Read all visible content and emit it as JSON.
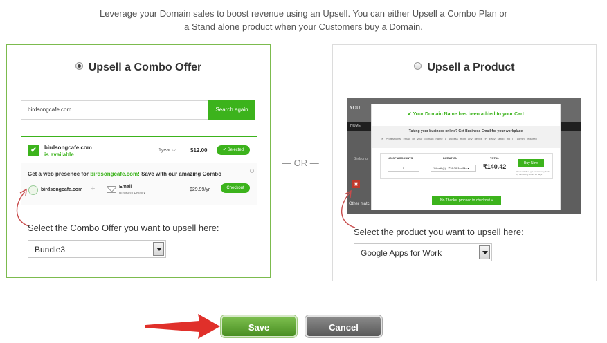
{
  "intro": {
    "line1": "Leverage your Domain sales to boost revenue using an Upsell. You can either Upsell a Combo Plan or",
    "line2": "a Stand alone product when your Customers buy a Domain."
  },
  "combo_panel": {
    "option_label": "Upsell a Combo Offer",
    "selected": true,
    "preview": {
      "search_value": "birdsongcafe.com",
      "search_button": "Search again",
      "domain": "birdsongcafe.com",
      "availability": "is available",
      "term": "1year",
      "price": "$12.00",
      "selected_button": "✔ Selected",
      "promo_prefix": "Get a web presence for ",
      "promo_domain": "birdsongcafe.com!",
      "promo_suffix": " Save with our amazing Combo",
      "bundle_domain": "birdsongcafe.com",
      "bundle_plus": "+",
      "email_label": "Email",
      "email_sub": "Business Email ▾",
      "bundle_price": "$29.99/yr",
      "checkout_button": "Checkout"
    },
    "select_label": "Select the Combo Offer you want to upsell here:",
    "dropdown_value": "Bundle3"
  },
  "or_label": "— OR —",
  "product_panel": {
    "option_label": "Upsell a Product",
    "selected": false,
    "preview": {
      "brand": "YOU",
      "nav": "HOME",
      "bg_text": "Birdsong",
      "red_icon": "✖",
      "other": "Other matc",
      "modal_title": "✔ Your Domain Name has been added to your Cart",
      "question": "Taking your business online? Get Business Email for your workplace",
      "features": "✔ Professional email @ your domain name   ✔ Access from any device   ✔ Easy setup, no IT admin required",
      "col_accounts": "NO.OF ACCOUNTS",
      "col_duration": "DURATION",
      "col_total": "TOTAL",
      "accounts_value": "5",
      "duration_value": "1Month(s) - ₹28.08/Acc/Mo ▾",
      "total_value": "₹140.42",
      "buy_button": "Buy Now",
      "fine_print": "If not satisfied, get your money back by cancelling within 30 days",
      "no_thanks": "No Thanks, proceed to checkout »"
    },
    "select_label": "Select the product you want to upsell here:",
    "dropdown_value": "Google Apps for Work"
  },
  "actions": {
    "save": "Save",
    "cancel": "Cancel"
  },
  "colors": {
    "accent_green": "#3cb31c",
    "arrow_red": "#e0302a"
  }
}
